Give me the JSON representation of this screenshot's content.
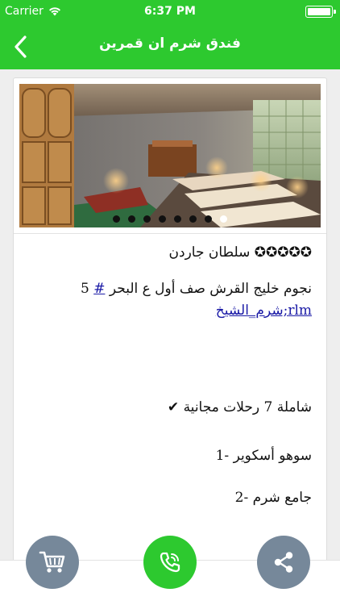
{
  "status_bar": {
    "carrier": "Carrier",
    "time": "6:37 PM"
  },
  "nav": {
    "title": "فندق شرم ان قمرين"
  },
  "gallery": {
    "dot_count": 8,
    "active_index": 7
  },
  "content": {
    "hotel_name": "✪✪✪✪✪ سلطان جاردن",
    "desc_text": "نجوم خليج القرش صف أول ع البحر ",
    "desc_hash": "#",
    "desc_num": " 5",
    "desc_hashtag": "rlm;شرم_الشيخ",
    "trips": "شاملة 7 رحلات مجانية ✔",
    "tour1": "سوهو أسكوير -1",
    "tour2": "جامع شرم -2"
  },
  "actions": {
    "cart": "cart-icon",
    "call": "phone-icon",
    "share": "share-icon"
  },
  "colors": {
    "accent": "#2dc92f",
    "fab_gray": "#76889a",
    "link": "#1a1aa6"
  }
}
